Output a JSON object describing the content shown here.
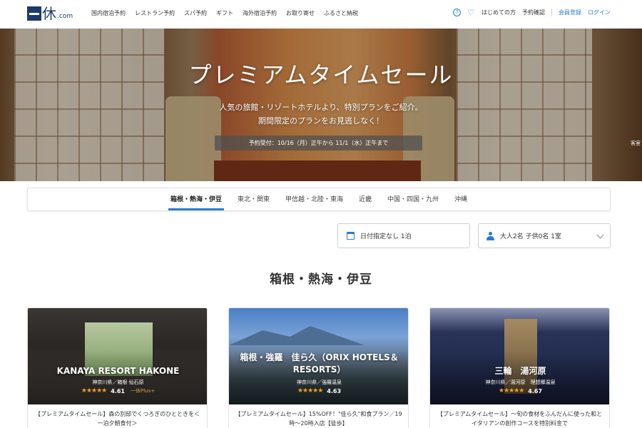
{
  "header": {
    "logo_kanji": "休",
    "logo_com": ".com",
    "nav": [
      "国内宿泊予約",
      "レストラン予約",
      "スパ予約",
      "ギフト",
      "海外宿泊予約",
      "お取り寄せ",
      "ふるさと納税"
    ],
    "right": {
      "help_icon": "?",
      "favorite_icon": "♡",
      "first_time": "はじめての方",
      "reservation_check": "予約確認",
      "register": "会員登録",
      "login": "ログイン"
    }
  },
  "hero": {
    "title": "プレミアムタイムセール",
    "sub1": "人気の旅館・リゾートホテルより、特別プランをご紹介。",
    "sub2": "期間限定のプランをお見逃しなく！",
    "period": "予約受付：10/16（月）正午から 11/1（水）正午まで",
    "credit": "客室"
  },
  "regions": [
    "箱根・熱海・伊豆",
    "東北・関東",
    "甲信越・北陸・東海",
    "近畿",
    "中国・四国・九州",
    "沖縄"
  ],
  "active_region": 0,
  "search": {
    "date": "日付指定なし 1泊",
    "guests": "大人2名  子供0名  1室"
  },
  "section_title": "箱根・熱海・伊豆",
  "cards": [
    {
      "name": "KANAYA RESORT HAKONE",
      "area": "神奈川県／箱根 仙石原",
      "stars": "★★★★★",
      "rating": "4.61",
      "badge": "一休Plus+",
      "desc": "【プレミアムタイムセール】森の別邸でくつろぎのひとときを＜一泊夕朝食付＞"
    },
    {
      "name": "箱根・強羅　佳ら久（ORIX HOTELS＆RESORTS）",
      "area": "神奈川県／強羅温泉",
      "stars": "★★★★★",
      "rating": "4.63",
      "badge": "",
      "desc": "【プレミアムタイムセール】15%OFF！\"佳ら久\"和食プラン／19時〜20時入店【徒歩】"
    },
    {
      "name": "三輪　湯河原",
      "area": "神奈川県／湯河原　理想郷温泉",
      "stars": "★★★★★",
      "rating": "4.67",
      "badge": "",
      "desc": "【プレミアムタイムセール】〜旬の食材をふんだんに使った和とイタリアンの創作コースを特別料金で"
    }
  ],
  "colors": {
    "accent": "#2a7ad1",
    "brand": "#1b3a6b",
    "star": "#f0a020"
  }
}
